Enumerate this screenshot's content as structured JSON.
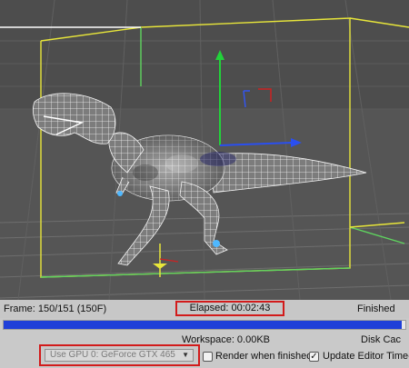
{
  "status": {
    "frame": "Frame: 150/151 (150F)",
    "elapsed": "Elapsed: 00:02:43",
    "state": "Finished"
  },
  "progress": {
    "fraction": 0.99
  },
  "footer": {
    "workspace": "Workspace: 0.00KB",
    "disk_cache": "Disk Cac",
    "gpu_select_value": "Use GPU 0: GeForce GTX 465",
    "render_when_finished_label": "Render when finished",
    "render_when_finished_checked": false,
    "update_editor_label": "Update Editor Time-lin",
    "update_editor_checked": true
  },
  "colors": {
    "highlight": "#d21b1b",
    "progress": "#1f3fd8",
    "axis_x": "#2a4ff0",
    "axis_y": "#22d23a",
    "bbox_yellow": "#e8e63a",
    "bbox_green": "#5fd45f"
  },
  "icons": {
    "gpu_dropdown": "chevron-down-icon",
    "checkbox_on": "checkmark-icon"
  }
}
